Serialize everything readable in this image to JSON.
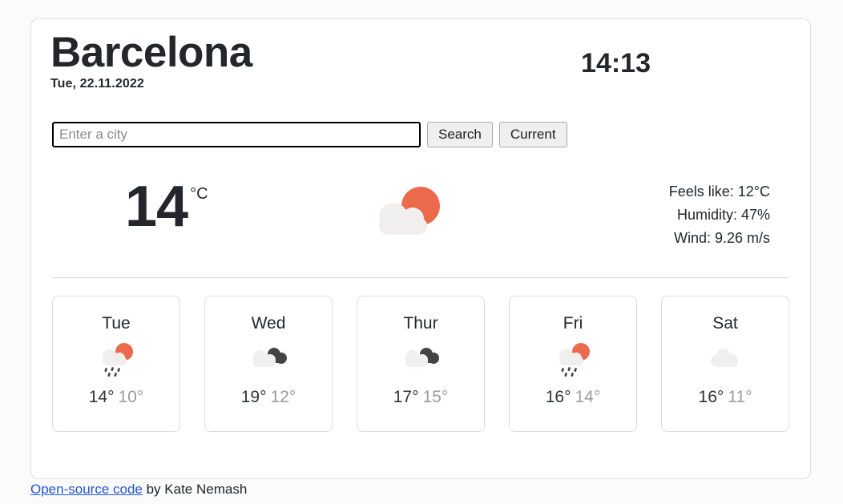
{
  "header": {
    "city": "Barcelona",
    "date": "Tue, 22.11.2022",
    "time": "14:13"
  },
  "search": {
    "placeholder": "Enter a city",
    "value": "",
    "search_label": "Search",
    "current_label": "Current"
  },
  "current": {
    "temperature": "14",
    "unit": "°C",
    "icon": "sun-behind-cloud-icon",
    "feels_like": "Feels like: 12°C",
    "humidity": "Humidity: 47%",
    "wind": "Wind: 9.26 m/s"
  },
  "forecast": [
    {
      "day": "Tue",
      "icon": "sun-behind-rain-cloud-icon",
      "max": "14°",
      "min": "10°"
    },
    {
      "day": "Wed",
      "icon": "dark-cloud-icon",
      "max": "19°",
      "min": "12°"
    },
    {
      "day": "Thur",
      "icon": "dark-cloud-icon",
      "max": "17°",
      "min": "15°"
    },
    {
      "day": "Fri",
      "icon": "sun-behind-rain-cloud-icon",
      "max": "16°",
      "min": "14°"
    },
    {
      "day": "Sat",
      "icon": "cloud-icon",
      "max": "16°",
      "min": "11°"
    }
  ],
  "footer": {
    "link_text": "Open-source code",
    "byline": " by Kate Nemash"
  },
  "colors": {
    "sun": "#ec6a4c",
    "cloud_light": "#f0efed",
    "cloud_dark": "#444444",
    "raindrop": "#3f3f3f",
    "link": "#2155cd"
  }
}
